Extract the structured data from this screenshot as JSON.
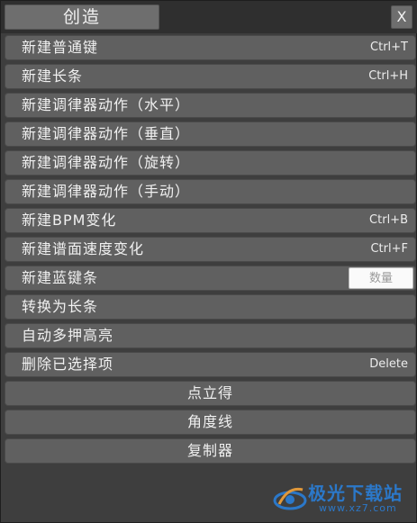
{
  "window": {
    "title": "创造",
    "close_label": "X"
  },
  "menu": {
    "items": [
      {
        "label": "新建普通键",
        "shortcut": "Ctrl+T"
      },
      {
        "label": "新建长条",
        "shortcut": "Ctrl+H"
      },
      {
        "label": "新建调律器动作（水平）",
        "shortcut": ""
      },
      {
        "label": "新建调律器动作（垂直）",
        "shortcut": ""
      },
      {
        "label": "新建调律器动作（旋转）",
        "shortcut": ""
      },
      {
        "label": "新建调律器动作（手动）",
        "shortcut": ""
      },
      {
        "label": "新建BPM变化",
        "shortcut": "Ctrl+B"
      },
      {
        "label": "新建谱面速度变化",
        "shortcut": "Ctrl+F"
      },
      {
        "label": "新建蓝键条",
        "input_placeholder": "数量"
      },
      {
        "label": "转换为长条",
        "shortcut": ""
      },
      {
        "label": "自动多押高亮",
        "shortcut": ""
      },
      {
        "label": "删除已选择项",
        "shortcut": "Delete"
      },
      {
        "label": "点立得",
        "shortcut": ""
      },
      {
        "label": "角度线",
        "shortcut": ""
      },
      {
        "label": "复制器",
        "shortcut": ""
      }
    ]
  },
  "watermark": {
    "brand": "极光下载站",
    "url": "www.xz7.com",
    "color": "#2a7fd9"
  }
}
